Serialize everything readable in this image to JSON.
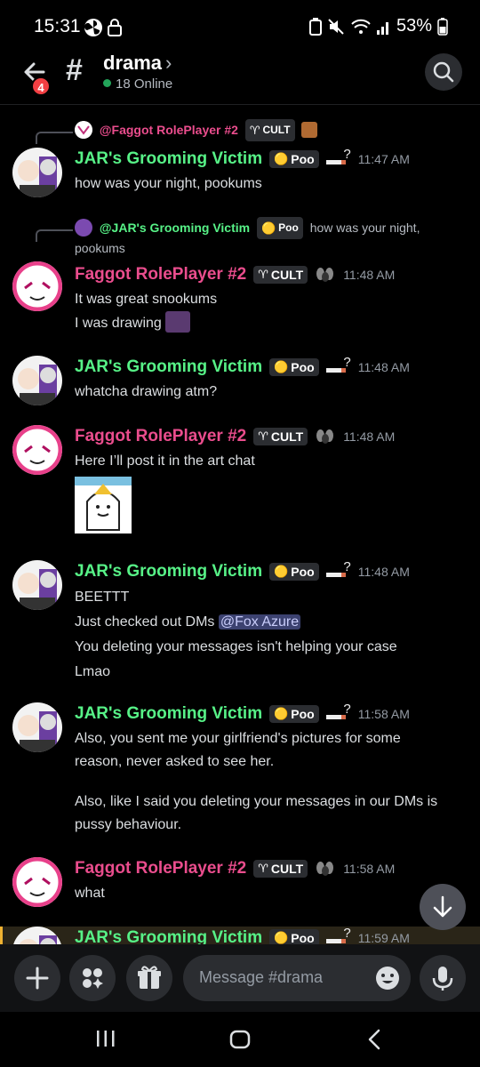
{
  "status_bar": {
    "time": "15:31",
    "battery": "53%"
  },
  "header": {
    "back_badge": "4",
    "channel_name": "drama",
    "online": "18 Online"
  },
  "tags": {
    "cult": "CULT",
    "poo": "Poo"
  },
  "messages": [
    {
      "reply_author": "@Faggot RolePlayer #2",
      "author": "JAR's Grooming Victim",
      "time": "11:47 AM",
      "lines": [
        "how was your night, pookums"
      ]
    },
    {
      "reply_author": "@JAR's Grooming Victim",
      "reply_text": "how was your night,",
      "reply_text2": "pookums",
      "author": "Faggot RolePlayer #2",
      "time": "11:48 AM",
      "lines": [
        "It was great snookums",
        "I was drawing"
      ]
    },
    {
      "author": "JAR's Grooming Victim",
      "time": "11:48 AM",
      "lines": [
        "whatcha drawing atm?"
      ]
    },
    {
      "author": "Faggot RolePlayer #2",
      "time": "11:48 AM",
      "lines": [
        "Here I’ll post it in the art chat"
      ]
    },
    {
      "author": "JAR's Grooming Victim",
      "time": "11:48 AM",
      "lines": [
        "BEETTT",
        "Just checked out DMs",
        "You deleting your messages isn't helping your case",
        "Lmao"
      ],
      "mention": "@Fox Azure"
    },
    {
      "author": "JAR's Grooming Victim",
      "time": "11:58 AM",
      "lines": [
        "Also, you sent me your girlfriend's pictures for some",
        "reason, never asked to see her.",
        "Also, like I said you deleting your messages in our DMs is",
        "pussy behaviour."
      ]
    },
    {
      "author": "Faggot RolePlayer #2",
      "time": "11:58 AM",
      "lines": [
        "what"
      ]
    },
    {
      "author": "JAR's Grooming Victim",
      "time": "11:59 AM"
    }
  ],
  "composer": {
    "placeholder": "Message #drama"
  },
  "colors": {
    "green_name": "#57f287",
    "pink_name": "#ea4d8d",
    "background": "#000000",
    "mention_bg": "#3c4270"
  }
}
